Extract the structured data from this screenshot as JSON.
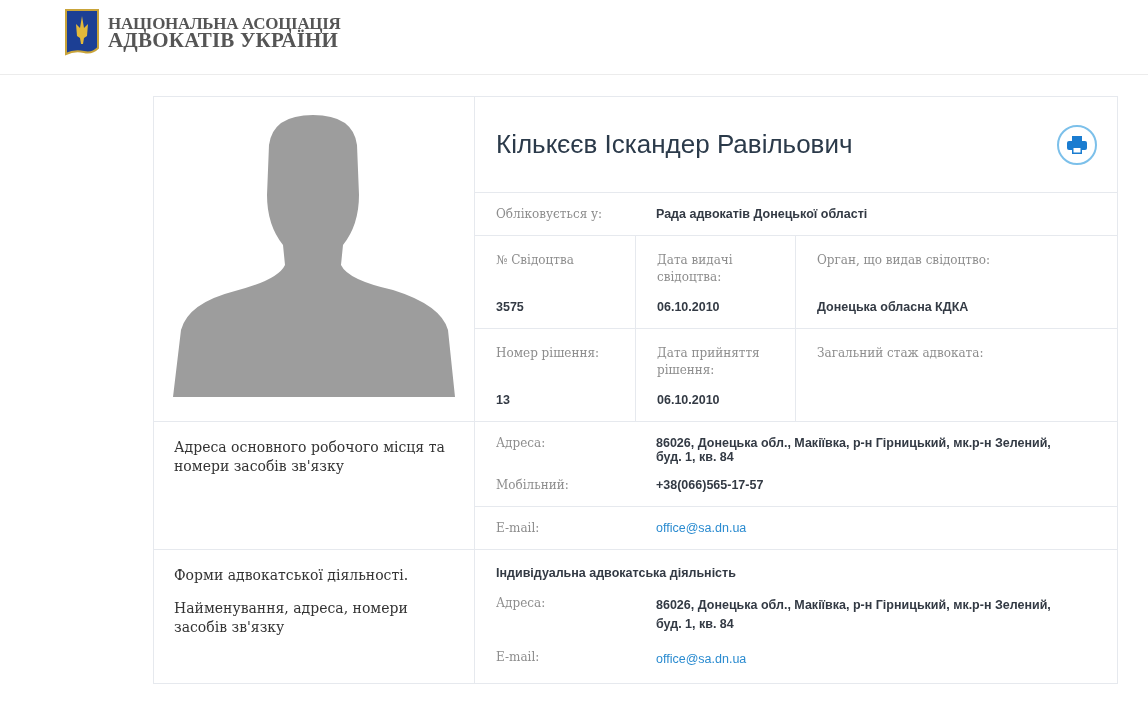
{
  "header": {
    "logo_lines": [
      "НАЦІОНАЛЬНА АСОЦІАЦІЯ",
      "АДВОКАТІВ УКРАЇНИ"
    ]
  },
  "profile": {
    "name": "Кількєєв Іскандер Равільович"
  },
  "registration": {
    "label": "Обліковується у:",
    "value": "Рада адвокатів Донецької області"
  },
  "detail_rows": [
    [
      {
        "label": "№ Свідоцтва",
        "value": "3575"
      },
      {
        "label": "Дата видачі свідоцтва:",
        "value": "06.10.2010"
      },
      {
        "label": "Орган, що видав свідоцтво:",
        "value": "Донецька обласна КДКА"
      }
    ],
    [
      {
        "label": "Номер рішення:",
        "value": "13"
      },
      {
        "label": "Дата прийняття рішення:",
        "value": "06.10.2010"
      },
      {
        "label": "Загальний стаж адвоката:"
      }
    ]
  ],
  "contacts": {
    "title": "Адреса основного робочого місця та номери засобів зв'язку",
    "groups": [
      [
        {
          "label": "Адреса:",
          "value": "86026, Донецька обл., Макіївка, р-н Гірницький, мк.р-н Зелений, буд. 1, кв. 84",
          "kind": "text"
        },
        {
          "label": "Мобільний:",
          "value": "+38(066)565-17-57",
          "kind": "text"
        }
      ],
      [
        {
          "label": "E-mail:",
          "value": "office@sa.dn.ua",
          "kind": "link"
        }
      ]
    ]
  },
  "activity": {
    "title_paragraphs": [
      "Форми адвокатської діяльності.",
      "Найменування, адреса, номери засобів зв'язку"
    ],
    "form": "Індивідуальна адвокатська діяльність",
    "fields": [
      {
        "label": "Адреса:",
        "value": "86026, Донецька обл., Макіївка, р-н Гірницький, мк.р-н Зелений, буд. 1, кв. 84",
        "kind": "text"
      },
      {
        "label": "E-mail:",
        "value": "office@sa.dn.ua",
        "kind": "link"
      }
    ]
  }
}
